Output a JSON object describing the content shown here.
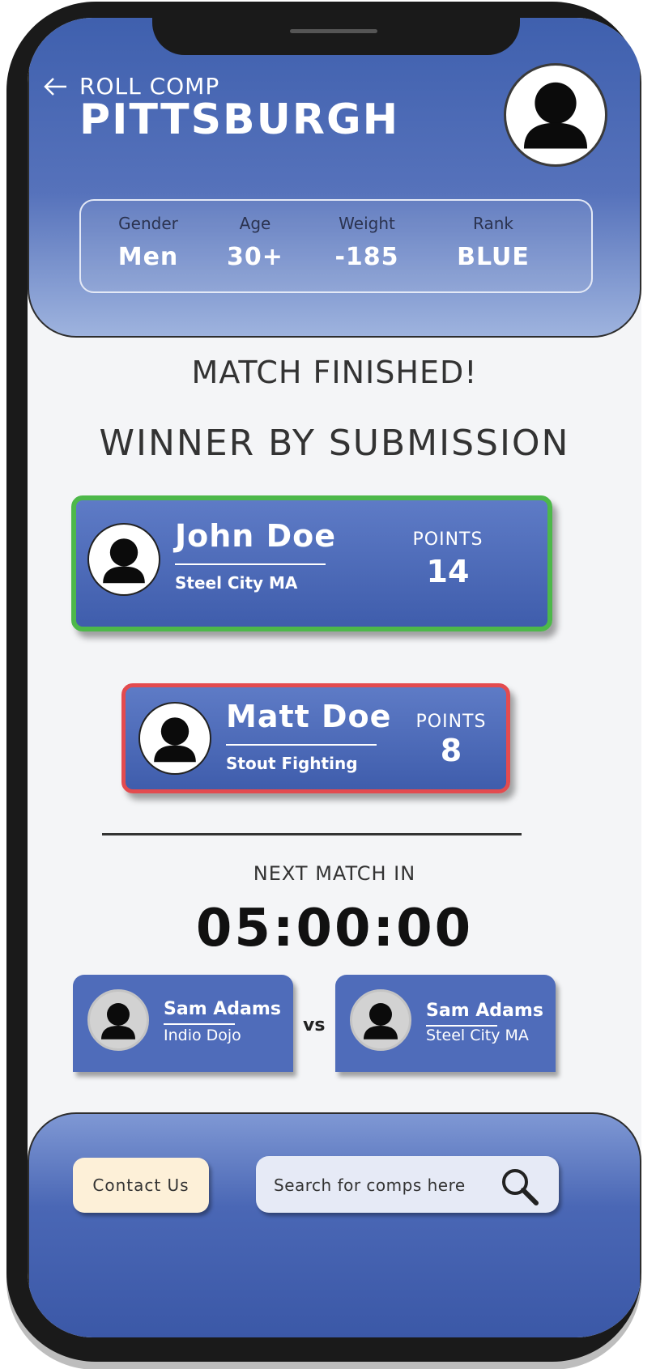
{
  "header": {
    "subtitle": "ROLL COMP",
    "title": "PITTSBURGH"
  },
  "filters": [
    {
      "label": "Gender",
      "value": "Men"
    },
    {
      "label": "Age",
      "value": "30+"
    },
    {
      "label": "Weight",
      "value": "-185"
    },
    {
      "label": "Rank",
      "value": "BLUE"
    }
  ],
  "result": {
    "status": "MATCH FINISHED!",
    "method": "WINNER BY SUBMISSION"
  },
  "winner": {
    "name": "John Doe",
    "club": "Steel City MA",
    "points_label": "POINTS",
    "points": "14"
  },
  "loser": {
    "name": "Matt Doe",
    "club": "Stout Fighting",
    "points_label": "POINTS",
    "points": "8"
  },
  "next_match": {
    "label": "NEXT MATCH IN",
    "countdown": "05:00:00",
    "vs": "vs",
    "competitors": [
      {
        "name": "Sam Adams",
        "club": "Indio Dojo"
      },
      {
        "name": "Sam Adams",
        "club": "Steel City MA"
      }
    ]
  },
  "footer": {
    "contact_label": "Contact Us",
    "search_placeholder": "Search for comps here"
  },
  "colors": {
    "primary": "#3f5dac",
    "winner_border": "#4db84a",
    "loser_border": "#e34b4f",
    "contact_button": "#fdf0d8"
  },
  "icons": [
    "back-arrow-icon",
    "user-avatar-icon",
    "search-icon"
  ]
}
